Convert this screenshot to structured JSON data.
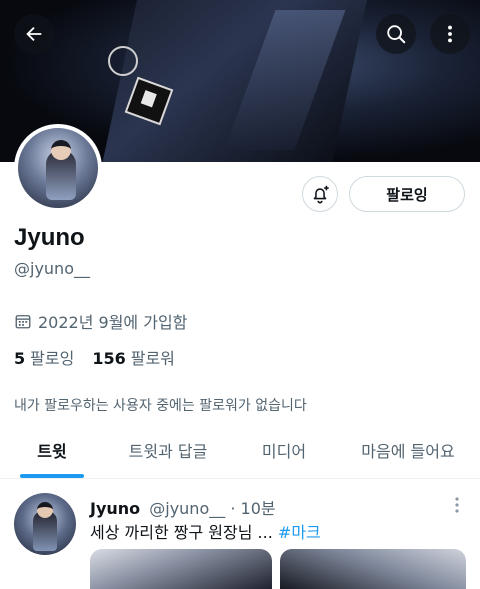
{
  "header": {
    "back_icon": "arrow-left-icon",
    "search_icon": "search-icon",
    "more_icon": "more-vertical-icon"
  },
  "profile": {
    "name": "Jyuno",
    "handle": "@jyuno__",
    "joined": "2022년 9월에 가입함",
    "following_count": "5",
    "following_label": "팔로잉",
    "followers_count": "156",
    "followers_label": "팔로워",
    "followers_you_know": "내가 팔로우하는 사용자 중에는 팔로워가 없습니다"
  },
  "actions": {
    "notify_icon": "bell-plus-icon",
    "follow_state_label": "팔로잉"
  },
  "tabs": [
    {
      "label": "트윗",
      "active": true
    },
    {
      "label": "트윗과 답글",
      "active": false
    },
    {
      "label": "미디어",
      "active": false
    },
    {
      "label": "마음에 들어요",
      "active": false
    }
  ],
  "tweet": {
    "author_name": "Jyuno",
    "author_handle": "@jyuno__",
    "separator": "·",
    "time": "10분",
    "text": "세상 까리한 짱구 원장님 ...",
    "hashtag": "#마크"
  },
  "colors": {
    "accent": "#1d9bf0",
    "text_primary": "#0f1419",
    "text_secondary": "#536471",
    "border": "#cfd9de"
  }
}
